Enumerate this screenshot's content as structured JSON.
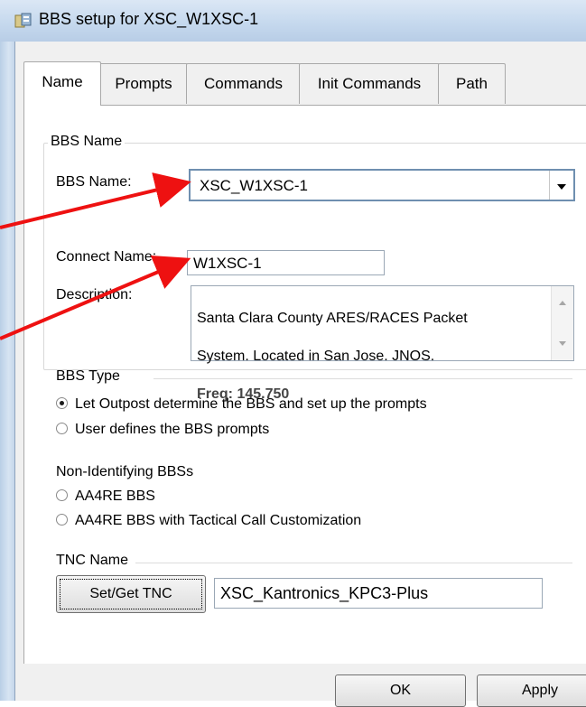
{
  "window": {
    "title": "BBS setup for XSC_W1XSC-1"
  },
  "tabs": [
    "Name",
    "Prompts",
    "Commands",
    "Init Commands",
    "Path"
  ],
  "bbs_name_group": {
    "title": "BBS Name",
    "bbs_name_label": "BBS Name:",
    "bbs_name_value": "XSC_W1XSC-1",
    "connect_name_label": "Connect Name:",
    "connect_name_value": "W1XSC-1",
    "description_label": "Description:",
    "description_line1": "Santa Clara County ARES/RACES Packet",
    "description_line2": "System.  Located in San Jose.  JNOS.",
    "description_line3": "Freq: 145.750"
  },
  "bbs_type": {
    "title": "BBS Type",
    "option1": "Let Outpost determine the BBS and set up the prompts",
    "option2": "User defines the BBS prompts",
    "selected": "option1"
  },
  "non_identifying": {
    "title": "Non-Identifying BBSs",
    "option1": "AA4RE BBS",
    "option2": "AA4RE BBS with Tactical Call Customization"
  },
  "tnc": {
    "title": "TNC Name",
    "button_label": "Set/Get TNC",
    "value": "XSC_Kantronics_KPC3-Plus"
  },
  "footer": {
    "ok_label": "OK",
    "apply_label": "Apply"
  },
  "colors": {
    "arrow": "#ee1111",
    "titlebar": "#c6d9ee",
    "dialog_bg": "#f0f0f0"
  }
}
